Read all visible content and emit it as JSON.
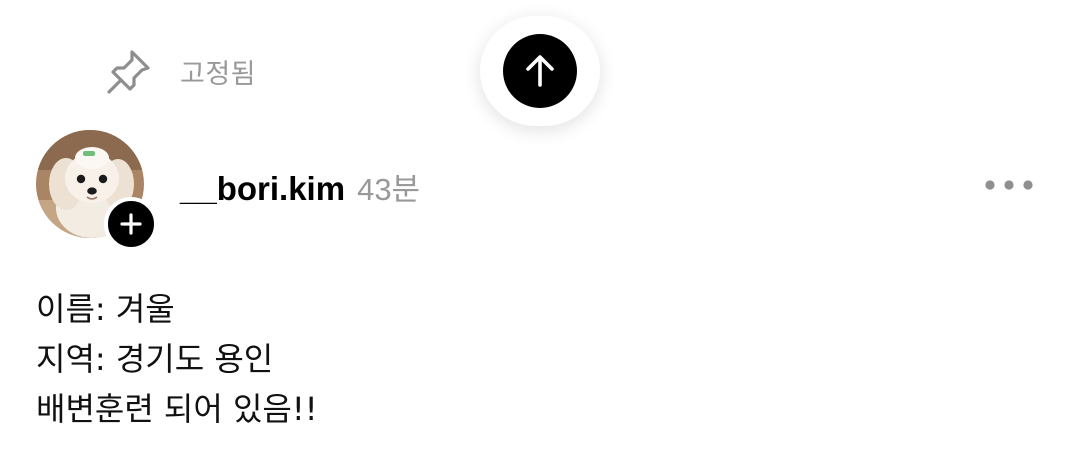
{
  "pinned": {
    "label": "고정됨",
    "icon": "pin-icon"
  },
  "scroll_top": {
    "icon": "arrow-up-icon"
  },
  "post": {
    "author": {
      "username": "__bori.kim",
      "avatar": "avatar",
      "follow_icon": "plus-icon"
    },
    "time": "43분",
    "more_icon": "more-dots-icon",
    "lines": [
      "이름: 겨울",
      "지역: 경기도 용인",
      "배변훈련 되어 있음!!"
    ]
  },
  "colors": {
    "text_primary": "#000000",
    "text_muted": "#999999",
    "button_dark": "#000000",
    "background": "#ffffff"
  }
}
